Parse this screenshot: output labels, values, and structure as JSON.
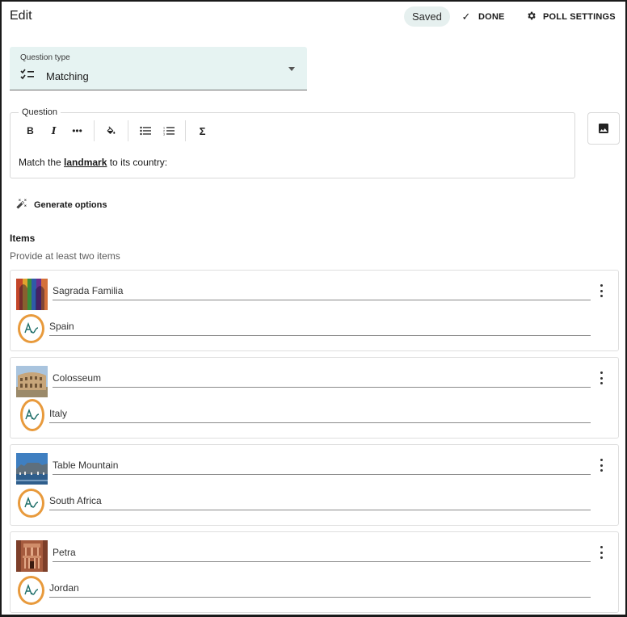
{
  "header": {
    "title": "Edit",
    "saved_label": "Saved",
    "done_label": "DONE",
    "poll_settings_label": "POLL SETTINGS"
  },
  "question_type": {
    "label": "Question type",
    "value": "Matching",
    "icon": "checklist-icon"
  },
  "question": {
    "legend": "Question",
    "text_before": "Match the ",
    "text_keyword": "landmark",
    "text_after": " to its country:",
    "toolbar": [
      "bold",
      "italic",
      "more",
      "highlight",
      "bulleted-list",
      "numbered-list",
      "equation"
    ]
  },
  "generate_options_label": "Generate options",
  "items": {
    "title": "Items",
    "subtitle": "Provide at least two items",
    "list": [
      {
        "term": "Sagrada Familia",
        "match": "Spain"
      },
      {
        "term": "Colosseum",
        "match": "Italy"
      },
      {
        "term": "Table Mountain",
        "match": "South Africa"
      },
      {
        "term": "Petra",
        "match": "Jordan"
      }
    ]
  },
  "colors": {
    "accent_bg": "#e6f3f2",
    "highlight_ring": "#e89a3c",
    "match_icon": "#1f6f6a"
  }
}
